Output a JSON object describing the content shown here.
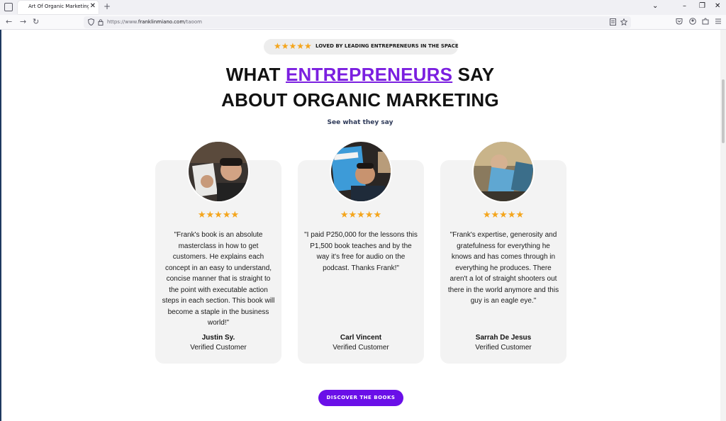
{
  "browser": {
    "tab_title": "Art Of Organic Marketing | My",
    "tab_close": "✕",
    "new_tab": "+",
    "url_prefix": "https://www.",
    "url_domain": "franklinmiano.com",
    "url_path": "/taoom",
    "controls": {
      "chevron": "⌄",
      "minimize": "–",
      "restore": "❐",
      "close": "✕"
    },
    "nav": {
      "back": "←",
      "forward": "→",
      "reload": "↻"
    }
  },
  "badge": {
    "stars": "★★★★★",
    "text": "LOVED BY LEADING ENTREPRENEURS IN THE SPACE"
  },
  "headline": {
    "line1_pre": "WHAT ",
    "line1_accent": "ENTREPRENEURS",
    "line1_post": " SAY",
    "line2": "ABOUT ORGANIC MARKETING"
  },
  "subhead": "See what they say",
  "testimonials": [
    {
      "stars": "★★★★★",
      "quote": "\"Frank's book is an absolute masterclass in how to get customers. He explains each concept in an easy to understand, concise manner that is straight to the point with executable action steps in each section. This book will become a staple in the business world!\"",
      "name": "Justin Sy.",
      "role": "Verified Customer"
    },
    {
      "stars": "★★★★★",
      "quote": "\"I paid P250,000 for the lessons this P1,500 book teaches and by the way it's free for audio on the podcast. Thanks Frank!\"",
      "name": "Carl Vincent",
      "role": "Verified Customer"
    },
    {
      "stars": "★★★★★",
      "quote": "\"Frank's expertise, generosity and gratefulness for everything he knows and has comes through in everything he produces. There aren't a lot of straight shooters out there in the world anymore and this guy is an eagle eye.\"",
      "name": "Sarrah De Jesus",
      "role": "Verified Customer"
    }
  ],
  "cta_label": "DISCOVER THE BOOKS",
  "colors": {
    "accent": "#7b1fe0",
    "cta": "#6a0fe8",
    "star": "#f4a51c",
    "card": "#f3f3f3"
  }
}
